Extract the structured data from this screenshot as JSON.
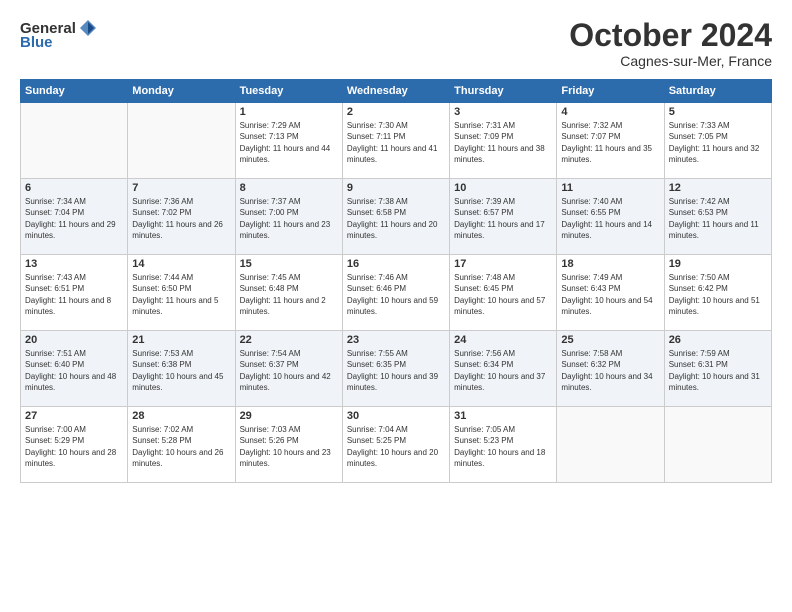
{
  "header": {
    "logo_general": "General",
    "logo_blue": "Blue",
    "title": "October 2024",
    "subtitle": "Cagnes-sur-Mer, France"
  },
  "days_of_week": [
    "Sunday",
    "Monday",
    "Tuesday",
    "Wednesday",
    "Thursday",
    "Friday",
    "Saturday"
  ],
  "weeks": [
    [
      {
        "day": "",
        "content": ""
      },
      {
        "day": "",
        "content": ""
      },
      {
        "day": "1",
        "content": "Sunrise: 7:29 AM\nSunset: 7:13 PM\nDaylight: 11 hours and 44 minutes."
      },
      {
        "day": "2",
        "content": "Sunrise: 7:30 AM\nSunset: 7:11 PM\nDaylight: 11 hours and 41 minutes."
      },
      {
        "day": "3",
        "content": "Sunrise: 7:31 AM\nSunset: 7:09 PM\nDaylight: 11 hours and 38 minutes."
      },
      {
        "day": "4",
        "content": "Sunrise: 7:32 AM\nSunset: 7:07 PM\nDaylight: 11 hours and 35 minutes."
      },
      {
        "day": "5",
        "content": "Sunrise: 7:33 AM\nSunset: 7:05 PM\nDaylight: 11 hours and 32 minutes."
      }
    ],
    [
      {
        "day": "6",
        "content": "Sunrise: 7:34 AM\nSunset: 7:04 PM\nDaylight: 11 hours and 29 minutes."
      },
      {
        "day": "7",
        "content": "Sunrise: 7:36 AM\nSunset: 7:02 PM\nDaylight: 11 hours and 26 minutes."
      },
      {
        "day": "8",
        "content": "Sunrise: 7:37 AM\nSunset: 7:00 PM\nDaylight: 11 hours and 23 minutes."
      },
      {
        "day": "9",
        "content": "Sunrise: 7:38 AM\nSunset: 6:58 PM\nDaylight: 11 hours and 20 minutes."
      },
      {
        "day": "10",
        "content": "Sunrise: 7:39 AM\nSunset: 6:57 PM\nDaylight: 11 hours and 17 minutes."
      },
      {
        "day": "11",
        "content": "Sunrise: 7:40 AM\nSunset: 6:55 PM\nDaylight: 11 hours and 14 minutes."
      },
      {
        "day": "12",
        "content": "Sunrise: 7:42 AM\nSunset: 6:53 PM\nDaylight: 11 hours and 11 minutes."
      }
    ],
    [
      {
        "day": "13",
        "content": "Sunrise: 7:43 AM\nSunset: 6:51 PM\nDaylight: 11 hours and 8 minutes."
      },
      {
        "day": "14",
        "content": "Sunrise: 7:44 AM\nSunset: 6:50 PM\nDaylight: 11 hours and 5 minutes."
      },
      {
        "day": "15",
        "content": "Sunrise: 7:45 AM\nSunset: 6:48 PM\nDaylight: 11 hours and 2 minutes."
      },
      {
        "day": "16",
        "content": "Sunrise: 7:46 AM\nSunset: 6:46 PM\nDaylight: 10 hours and 59 minutes."
      },
      {
        "day": "17",
        "content": "Sunrise: 7:48 AM\nSunset: 6:45 PM\nDaylight: 10 hours and 57 minutes."
      },
      {
        "day": "18",
        "content": "Sunrise: 7:49 AM\nSunset: 6:43 PM\nDaylight: 10 hours and 54 minutes."
      },
      {
        "day": "19",
        "content": "Sunrise: 7:50 AM\nSunset: 6:42 PM\nDaylight: 10 hours and 51 minutes."
      }
    ],
    [
      {
        "day": "20",
        "content": "Sunrise: 7:51 AM\nSunset: 6:40 PM\nDaylight: 10 hours and 48 minutes."
      },
      {
        "day": "21",
        "content": "Sunrise: 7:53 AM\nSunset: 6:38 PM\nDaylight: 10 hours and 45 minutes."
      },
      {
        "day": "22",
        "content": "Sunrise: 7:54 AM\nSunset: 6:37 PM\nDaylight: 10 hours and 42 minutes."
      },
      {
        "day": "23",
        "content": "Sunrise: 7:55 AM\nSunset: 6:35 PM\nDaylight: 10 hours and 39 minutes."
      },
      {
        "day": "24",
        "content": "Sunrise: 7:56 AM\nSunset: 6:34 PM\nDaylight: 10 hours and 37 minutes."
      },
      {
        "day": "25",
        "content": "Sunrise: 7:58 AM\nSunset: 6:32 PM\nDaylight: 10 hours and 34 minutes."
      },
      {
        "day": "26",
        "content": "Sunrise: 7:59 AM\nSunset: 6:31 PM\nDaylight: 10 hours and 31 minutes."
      }
    ],
    [
      {
        "day": "27",
        "content": "Sunrise: 7:00 AM\nSunset: 5:29 PM\nDaylight: 10 hours and 28 minutes."
      },
      {
        "day": "28",
        "content": "Sunrise: 7:02 AM\nSunset: 5:28 PM\nDaylight: 10 hours and 26 minutes."
      },
      {
        "day": "29",
        "content": "Sunrise: 7:03 AM\nSunset: 5:26 PM\nDaylight: 10 hours and 23 minutes."
      },
      {
        "day": "30",
        "content": "Sunrise: 7:04 AM\nSunset: 5:25 PM\nDaylight: 10 hours and 20 minutes."
      },
      {
        "day": "31",
        "content": "Sunrise: 7:05 AM\nSunset: 5:23 PM\nDaylight: 10 hours and 18 minutes."
      },
      {
        "day": "",
        "content": ""
      },
      {
        "day": "",
        "content": ""
      }
    ]
  ]
}
